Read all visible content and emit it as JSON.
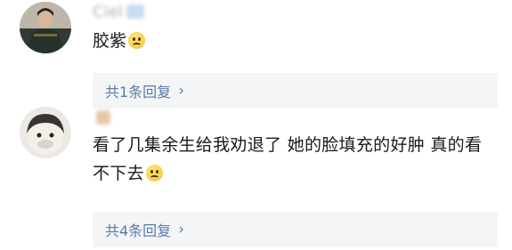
{
  "comments": [
    {
      "username": "Ciel",
      "text": "胶紫",
      "emoji_icon": "laughing-face-icon",
      "replies_label": "共1条回复"
    },
    {
      "username": "",
      "text": "看了几集余生给我劝退了 她的脸填充的好肿 真的看不下去",
      "emoji_icon": "pleading-face-icon",
      "replies_label": "共4条回复"
    }
  ],
  "icons": {
    "chevron": "chevron-right-icon"
  },
  "colors": {
    "reply_text": "#5b7aa6",
    "reply_bg": "#f4f5f7"
  }
}
